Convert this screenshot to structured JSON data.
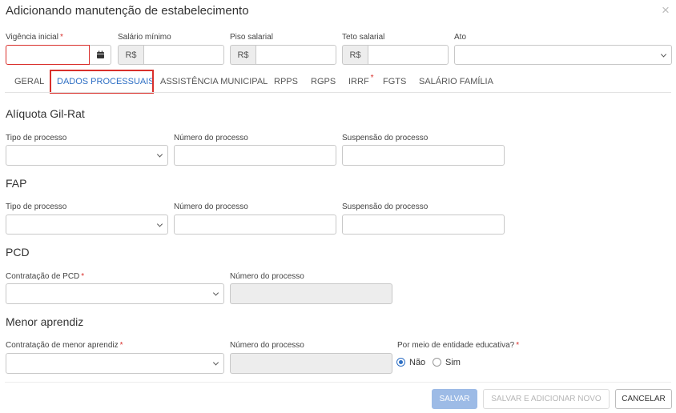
{
  "dialog": {
    "title": "Adicionando manutenção de estabelecimento",
    "close_glyph": "×"
  },
  "header_fields": {
    "vigencia": {
      "label": "Vigência inicial",
      "required_mark": "*",
      "value": ""
    },
    "salario_minimo": {
      "label": "Salário mínimo",
      "currency": "R$",
      "value": ""
    },
    "piso_salarial": {
      "label": "Piso salarial",
      "currency": "R$",
      "value": ""
    },
    "teto_salarial": {
      "label": "Teto salarial",
      "currency": "R$",
      "value": ""
    },
    "ato": {
      "label": "Ato",
      "value": ""
    }
  },
  "tabs": [
    {
      "label": "GERAL"
    },
    {
      "label": "DADOS PROCESSUAIS",
      "active": true
    },
    {
      "label": "ASSISTÊNCIA MUNICIPAL"
    },
    {
      "label": "RPPS"
    },
    {
      "label": "RGPS"
    },
    {
      "label": "IRRF",
      "required_mark": "*"
    },
    {
      "label": "FGTS"
    },
    {
      "label": "SALÁRIO FAMÍLIA"
    }
  ],
  "sections": {
    "gilrat": {
      "title": "Alíquota Gil-Rat",
      "tipo_label": "Tipo de processo",
      "numero_label": "Número do processo",
      "suspensao_label": "Suspensão do processo"
    },
    "fap": {
      "title": "FAP",
      "tipo_label": "Tipo de processo",
      "numero_label": "Número do processo",
      "suspensao_label": "Suspensão do processo"
    },
    "pcd": {
      "title": "PCD",
      "contratacao_label": "Contratação de PCD",
      "required_mark": "*",
      "numero_label": "Número do processo"
    },
    "menor": {
      "title": "Menor aprendiz",
      "contratacao_label": "Contratação de menor aprendiz",
      "contratacao_required": "*",
      "numero_label": "Número do processo",
      "entidade_label": "Por meio de entidade educativa?",
      "entidade_required": "*",
      "options": [
        "Não",
        "Sim"
      ],
      "selected": "Não"
    }
  },
  "footer": {
    "salvar": "SALVAR",
    "salvar_novo": "SALVAR E ADICIONAR NOVO",
    "cancelar": "CANCELAR"
  },
  "colors": {
    "accent": "#2e6fc4",
    "error": "#d9302c",
    "primary_button": "#9dbbe6"
  },
  "icons": [
    "close-icon",
    "calendar-icon",
    "chevron-down-icon"
  ]
}
